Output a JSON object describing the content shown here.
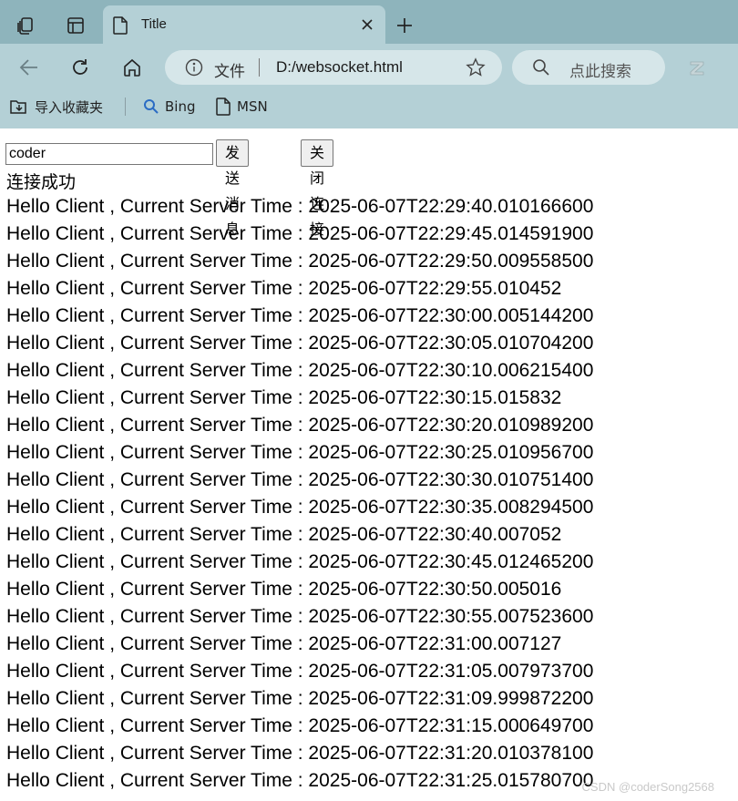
{
  "browser": {
    "tab": {
      "title": "Title"
    },
    "address": {
      "scheme_label": "文件",
      "url": "D:/websocket.html"
    },
    "search": {
      "placeholder": "点此搜索"
    },
    "favorites": [
      {
        "label": "导入收藏夹",
        "icon": "import-favorites-icon"
      },
      {
        "label": "Bing",
        "icon": "bing-search-icon"
      },
      {
        "label": "MSN",
        "icon": "page-icon"
      }
    ]
  },
  "page": {
    "input_value": "coder",
    "send_button": "发送消息",
    "close_button": "关闭连接",
    "status": "连接成功",
    "messages": [
      "Hello Client , Current Server Time : 2025-06-07T22:29:40.010166600",
      "Hello Client , Current Server Time : 2025-06-07T22:29:45.014591900",
      "Hello Client , Current Server Time : 2025-06-07T22:29:50.009558500",
      "Hello Client , Current Server Time : 2025-06-07T22:29:55.010452",
      "Hello Client , Current Server Time : 2025-06-07T22:30:00.005144200",
      "Hello Client , Current Server Time : 2025-06-07T22:30:05.010704200",
      "Hello Client , Current Server Time : 2025-06-07T22:30:10.006215400",
      "Hello Client , Current Server Time : 2025-06-07T22:30:15.015832",
      "Hello Client , Current Server Time : 2025-06-07T22:30:20.010989200",
      "Hello Client , Current Server Time : 2025-06-07T22:30:25.010956700",
      "Hello Client , Current Server Time : 2025-06-07T22:30:30.010751400",
      "Hello Client , Current Server Time : 2025-06-07T22:30:35.008294500",
      "Hello Client , Current Server Time : 2025-06-07T22:30:40.007052",
      "Hello Client , Current Server Time : 2025-06-07T22:30:45.012465200",
      "Hello Client , Current Server Time : 2025-06-07T22:30:50.005016",
      "Hello Client , Current Server Time : 2025-06-07T22:30:55.007523600",
      "Hello Client , Current Server Time : 2025-06-07T22:31:00.007127",
      "Hello Client , Current Server Time : 2025-06-07T22:31:05.007973700",
      "Hello Client , Current Server Time : 2025-06-07T22:31:09.999872200",
      "Hello Client , Current Server Time : 2025-06-07T22:31:15.000649700",
      "Hello Client , Current Server Time : 2025-06-07T22:31:20.010378100",
      "Hello Client , Current Server Time : 2025-06-07T22:31:25.015780700"
    ],
    "watermark": "CSDN @coderSong2568"
  },
  "colors": {
    "tabstrip": "#8eb4bc",
    "toolbar": "#b4d0d6",
    "address_bar": "#d6e6e9"
  }
}
